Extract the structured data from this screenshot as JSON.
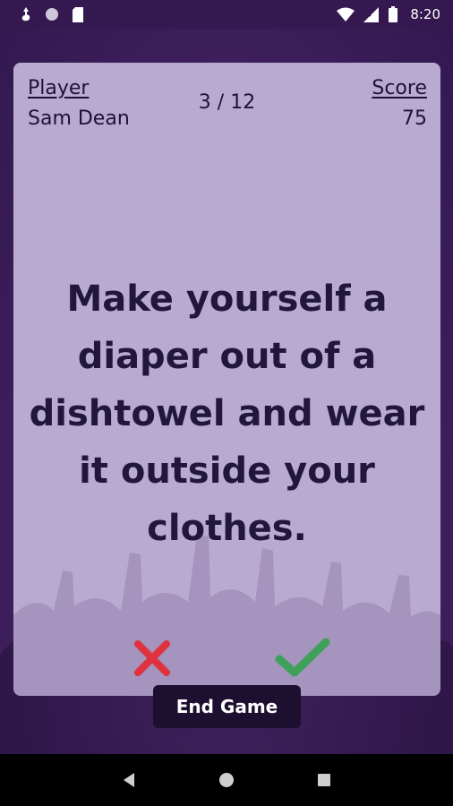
{
  "status_bar": {
    "time": "8:20",
    "icons": [
      "notification-icon",
      "circle-icon",
      "sd-card-icon",
      "wifi-icon",
      "signal-icon",
      "battery-icon"
    ]
  },
  "card": {
    "player_header": "Player",
    "player_name": "Sam Dean",
    "round": "3 / 12",
    "score_header": "Score",
    "score_value": "75",
    "challenge": "Make yourself a diaper out of a dishtowel and wear it outside your clothes.",
    "fail_icon": "x-mark-icon",
    "success_icon": "check-mark-icon"
  },
  "actions": {
    "end_game_label": "End Game"
  },
  "nav": {
    "icons": [
      "back-icon",
      "home-icon",
      "recents-icon"
    ]
  },
  "colors": {
    "background": "#3f1f5f",
    "card": "#b9aad0",
    "text": "#1e1337",
    "fail": "#e0313f",
    "success": "#3fa05a",
    "button": "#1c0f2f"
  }
}
